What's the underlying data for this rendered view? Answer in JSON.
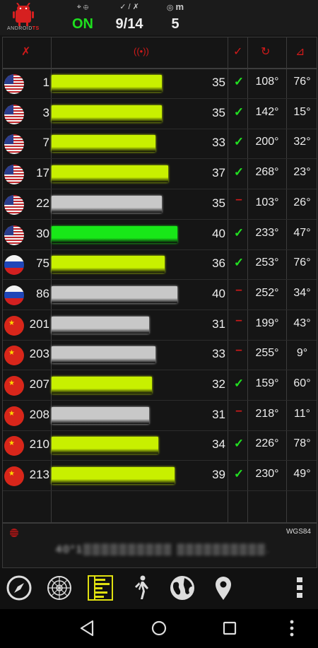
{
  "app": {
    "logo_text_a": "ANDROID",
    "logo_text_b": "TS"
  },
  "status": {
    "gps_icon": "satellite-fix-icon",
    "gps_state": "ON",
    "used_in_view": "9/14",
    "accuracy_unit": "m",
    "accuracy_value": "5"
  },
  "columns": [
    "satellite-off-icon",
    "signal-icon",
    "check-icon",
    "azimuth-icon",
    "elevation-icon"
  ],
  "rows": [
    {
      "country": "us",
      "prn": "1",
      "snr": "35",
      "snr_value": 35,
      "used": true,
      "color": "#c8f000",
      "az": "108°",
      "el": "76°"
    },
    {
      "country": "us",
      "prn": "3",
      "snr": "35",
      "snr_value": 35,
      "used": true,
      "color": "#c8f000",
      "az": "142°",
      "el": "15°"
    },
    {
      "country": "us",
      "prn": "7",
      "snr": "33",
      "snr_value": 33,
      "used": true,
      "color": "#c8f000",
      "az": "200°",
      "el": "32°"
    },
    {
      "country": "us",
      "prn": "17",
      "snr": "37",
      "snr_value": 37,
      "used": true,
      "color": "#c8f000",
      "az": "268°",
      "el": "23°"
    },
    {
      "country": "us",
      "prn": "22",
      "snr": "35",
      "snr_value": 35,
      "used": false,
      "color": "#c8c8c8",
      "az": "103°",
      "el": "26°"
    },
    {
      "country": "us",
      "prn": "30",
      "snr": "40",
      "snr_value": 40,
      "used": true,
      "color": "#18e818",
      "az": "233°",
      "el": "47°"
    },
    {
      "country": "ru",
      "prn": "75",
      "snr": "36",
      "snr_value": 36,
      "used": true,
      "color": "#c8f000",
      "az": "253°",
      "el": "76°"
    },
    {
      "country": "ru",
      "prn": "86",
      "snr": "40",
      "snr_value": 40,
      "used": false,
      "color": "#c8c8c8",
      "az": "252°",
      "el": "34°"
    },
    {
      "country": "cn",
      "prn": "201",
      "snr": "31",
      "snr_value": 31,
      "used": false,
      "color": "#c8c8c8",
      "az": "199°",
      "el": "43°"
    },
    {
      "country": "cn",
      "prn": "203",
      "snr": "33",
      "snr_value": 33,
      "used": false,
      "color": "#c8c8c8",
      "az": "255°",
      "el": "9°"
    },
    {
      "country": "cn",
      "prn": "207",
      "snr": "32",
      "snr_value": 32,
      "used": true,
      "color": "#c8f000",
      "az": "159°",
      "el": "60°"
    },
    {
      "country": "cn",
      "prn": "208",
      "snr": "31",
      "snr_value": 31,
      "used": false,
      "color": "#c8c8c8",
      "az": "218°",
      "el": "11°"
    },
    {
      "country": "cn",
      "prn": "210",
      "snr": "34",
      "snr_value": 34,
      "used": true,
      "color": "#c8f000",
      "az": "226°",
      "el": "78°"
    },
    {
      "country": "cn",
      "prn": "213",
      "snr": "39",
      "snr_value": 39,
      "used": true,
      "color": "#c8f000",
      "az": "230°",
      "el": "49°"
    }
  ],
  "footer": {
    "datum": "WGS84",
    "coordinates": "40°1▒▒▒▒▒▒▒▒▒▒  ▒▒▒▒▒▒▒▒▒▒."
  },
  "toolbar": [
    "compass-icon",
    "radar-icon",
    "signal-bars-icon",
    "walking-icon",
    "globe-icon",
    "map-pin-icon",
    "more-vert-icon"
  ],
  "sysnav": [
    "back-icon",
    "home-icon",
    "recents-icon",
    "more-vert-icon"
  ]
}
